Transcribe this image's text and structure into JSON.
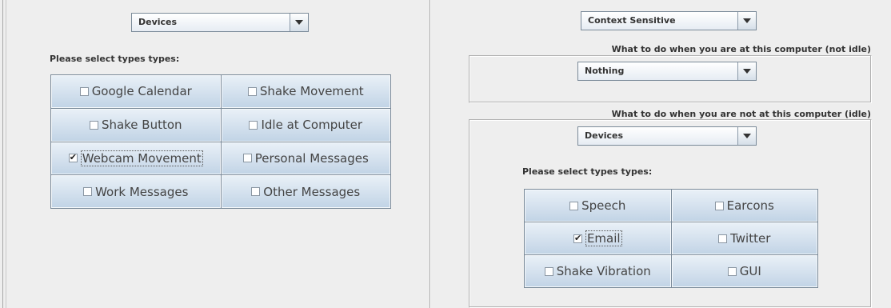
{
  "left": {
    "category_select": "Devices",
    "types_label": "Please select types types:",
    "items": [
      {
        "label": "Google Calendar",
        "checked": false
      },
      {
        "label": "Shake Movement",
        "checked": false
      },
      {
        "label": "Shake Button",
        "checked": false
      },
      {
        "label": "Idle at Computer",
        "checked": false
      },
      {
        "label": "Webcam Movement",
        "checked": true
      },
      {
        "label": "Personal Messages",
        "checked": false
      },
      {
        "label": "Work Messages",
        "checked": false
      },
      {
        "label": "Other Messages",
        "checked": false
      }
    ]
  },
  "right": {
    "mode_select": "Context Sensitive",
    "not_idle_heading": "What to do when you are at this computer (not idle)",
    "not_idle_select": "Nothing",
    "idle_heading": "What to do when you are not at this computer (idle)",
    "idle_select": "Devices",
    "types_label": "Please select types types:",
    "items": [
      {
        "label": "Speech",
        "checked": false
      },
      {
        "label": "Earcons",
        "checked": false
      },
      {
        "label": "Email",
        "checked": true
      },
      {
        "label": "Twitter",
        "checked": false
      },
      {
        "label": "Shake Vibration",
        "checked": false
      },
      {
        "label": "GUI",
        "checked": false
      }
    ]
  }
}
